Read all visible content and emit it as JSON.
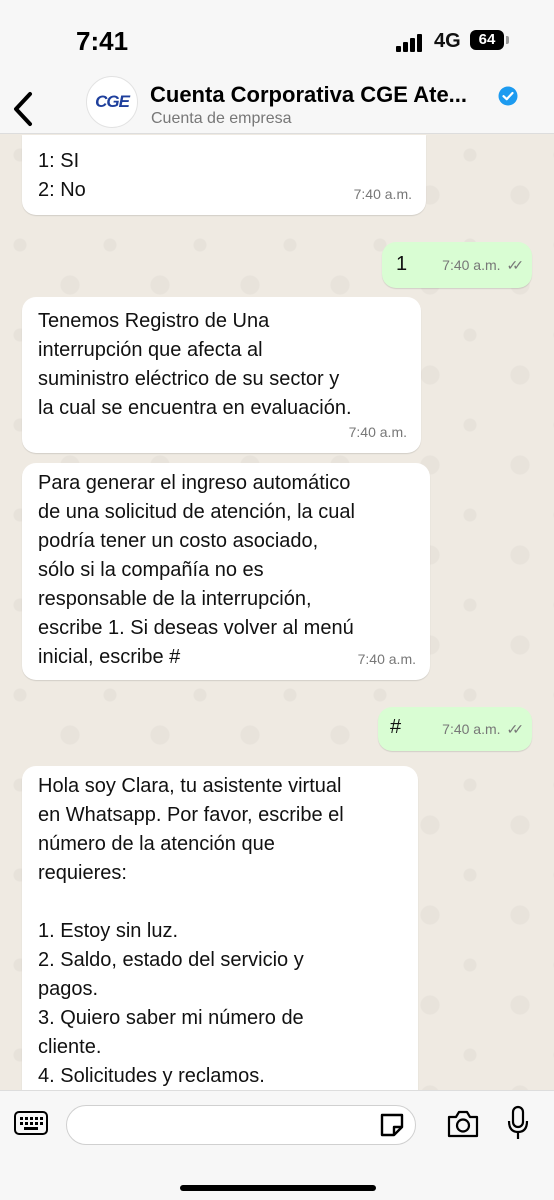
{
  "status": {
    "time": "7:41",
    "network": "4G",
    "battery": "64"
  },
  "header": {
    "avatar_text": "CGE",
    "contact_name": "Cuenta Corporativa CGE Ate...",
    "contact_subtitle": "Cuenta de empresa"
  },
  "messages": [
    {
      "direction": "in",
      "text": "1: SI\n2: No",
      "time": "7:40 a.m."
    },
    {
      "direction": "out",
      "text": "1",
      "time": "7:40 a.m."
    },
    {
      "direction": "in",
      "text": "Tenemos Registro de Una\ninterrupción que afecta al\nsuministro eléctrico de su sector y\nla cual se encuentra en evaluación.",
      "time": "7:40 a.m."
    },
    {
      "direction": "in",
      "text": "Para generar el ingreso automático\nde una solicitud de atención, la cual\npodría tener un costo asociado,\nsólo  si la compañía no es\nresponsable de la interrupción,\nescribe 1.  Si deseas volver al menú\ninicial, escribe #",
      "time": "7:40 a.m."
    },
    {
      "direction": "out",
      "text": "#",
      "time": "7:40 a.m."
    },
    {
      "direction": "in",
      "text": "Hola soy Clara, tu asistente virtual\nen Whatsapp. Por favor, escribe el\nnúmero de la atención que\nrequieres:\n\n1. Estoy sin luz.\n2. Saldo, estado del servicio y\n    pagos.\n3. Quiero saber mi número de\n    cliente.\n4. Solicitudes y reclamos.",
      "time": ""
    }
  ],
  "input": {
    "placeholder": ""
  },
  "colors": {
    "incoming_bubble": "#ffffff",
    "outgoing_bubble": "#d9fdd3",
    "chat_background": "#efeae2",
    "verified_badge": "#1d9bf0"
  },
  "icons": {
    "back": "chevron-left-icon",
    "verified": "verified-badge-icon",
    "keyboard": "keyboard-icon",
    "sticker": "sticker-icon",
    "camera": "camera-icon",
    "mic": "microphone-icon"
  }
}
